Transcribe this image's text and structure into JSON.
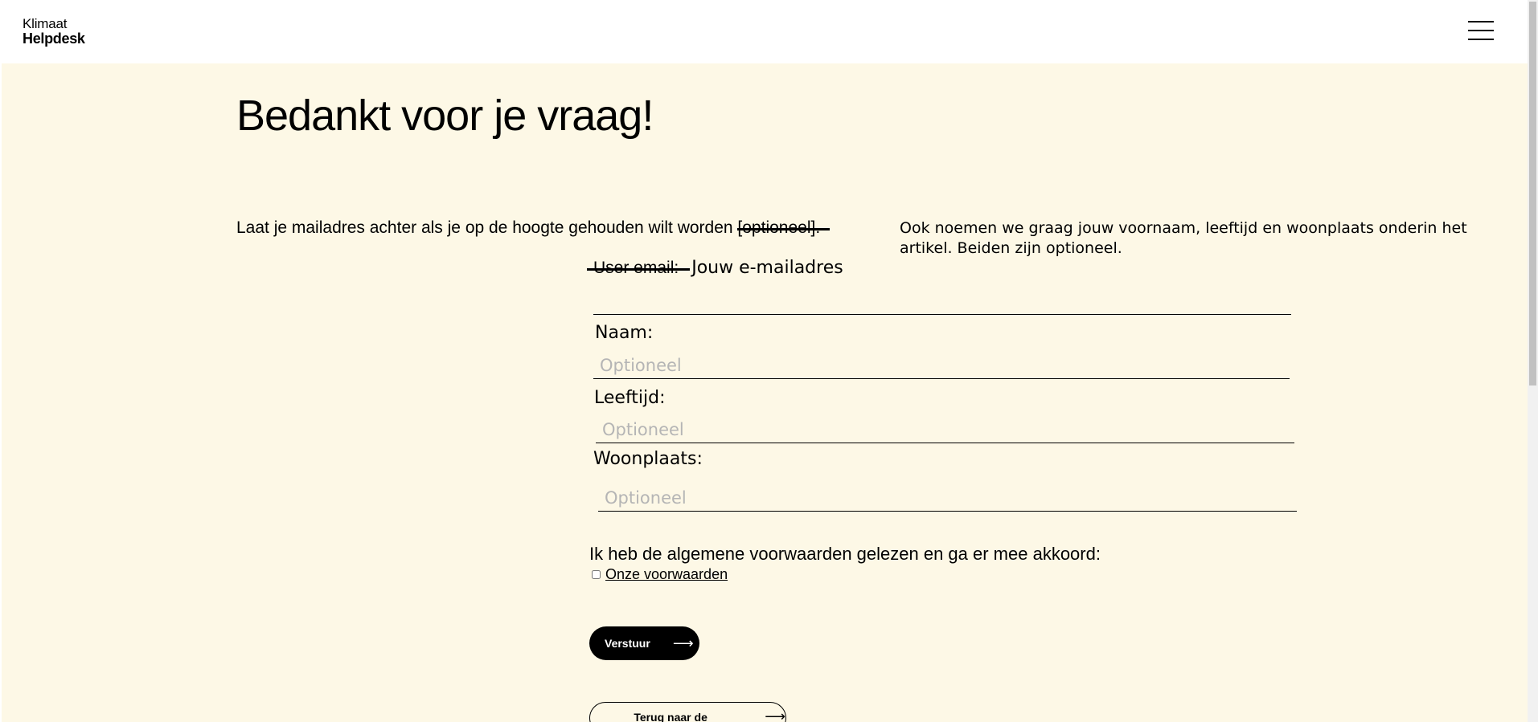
{
  "header": {
    "logo_line1": "Klimaat",
    "logo_line2": "Helpdesk",
    "menu_icon": "hamburger-menu-icon"
  },
  "main": {
    "title": "Bedankt voor je vraag!",
    "intro_text": "Laat je mailadres achter als je op de hoogte gehouden wilt worden ",
    "intro_struck": "[optioneel].",
    "aside_text": "Ook noemen we graag jouw voornaam, leeftijd en woonplaats onderin het artikel. Beiden zijn optioneel.",
    "email": {
      "label_struck": "User email:",
      "label": "Jouw e-mailadres",
      "value": ""
    },
    "fields": [
      {
        "label": "Naam:",
        "placeholder": "Optioneel",
        "value": ""
      },
      {
        "label": "Leeftijd:",
        "placeholder": "Optioneel",
        "value": ""
      },
      {
        "label": "Woonplaats:",
        "placeholder": "Optioneel",
        "value": ""
      }
    ],
    "terms": {
      "label": "Ik heb de algemene voorwaarden gelezen en ga er mee akkoord:",
      "link_text": "Onze voorwaarden",
      "checked": false
    },
    "send_button": {
      "label": "Verstuur",
      "icon": "arrow-right-icon"
    },
    "home_button": {
      "label": "Terug naar de homepage",
      "icon": "arrow-right-icon"
    }
  },
  "colors": {
    "background": "#fdf8e6",
    "header": "#ffffff",
    "text": "#000000",
    "placeholder": "#b5b5b5",
    "button": "#000000"
  }
}
